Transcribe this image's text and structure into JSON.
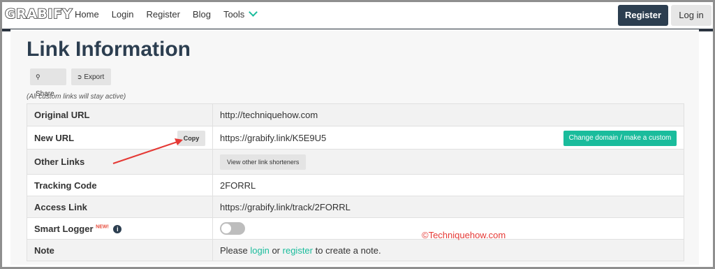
{
  "nav": {
    "logo": "GRABIFY",
    "links": [
      "Home",
      "Login",
      "Register",
      "Blog",
      "Tools"
    ],
    "register_button": "Register",
    "login_button": "Log in"
  },
  "page": {
    "title": "Link Information",
    "share_button": "Share",
    "export_button": "Export",
    "note": "(All custom links will stay active)"
  },
  "table": {
    "original_url": {
      "label": "Original URL",
      "value": "http://techniquehow.com"
    },
    "new_url": {
      "label": "New URL",
      "copy_button": "Copy",
      "value": "https://grabify.link/K5E9U5",
      "change_button": "Change domain / make a custom link"
    },
    "other_links": {
      "label": "Other Links",
      "button": "View other link shorteners"
    },
    "tracking_code": {
      "label": "Tracking Code",
      "value": "2FORRL"
    },
    "access_link": {
      "label": "Access Link",
      "value": "https://grabify.link/track/2FORRL"
    },
    "smart_logger": {
      "label": "Smart Logger",
      "badge": "NEW!",
      "enabled": false
    },
    "note": {
      "label": "Note",
      "prefix": "Please ",
      "login_link": "login",
      "middle": " or ",
      "register_link": "register",
      "suffix": " to create a note."
    }
  },
  "watermark": "©Techniquehow.com",
  "colors": {
    "accent": "#1abc9c",
    "dark": "#2c3e50",
    "annotation": "#e53935"
  }
}
